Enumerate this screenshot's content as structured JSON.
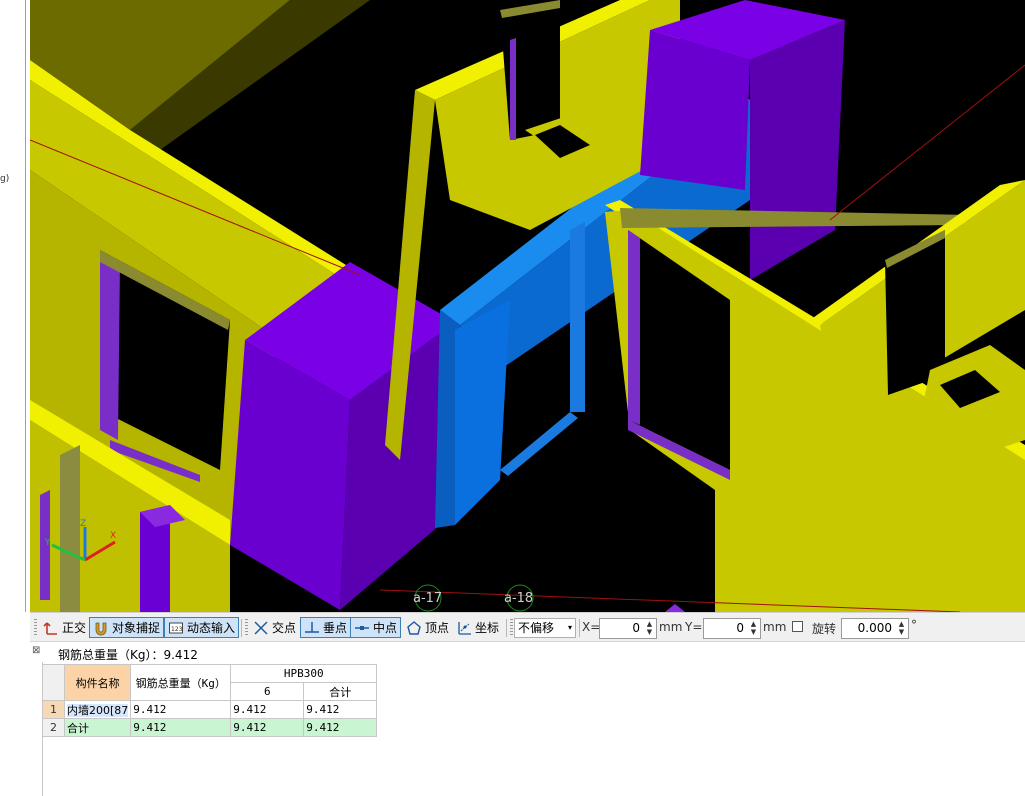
{
  "left_panel": {
    "fragment_text": "g)"
  },
  "viewport": {
    "axis_labels": [
      "a-17",
      "a-18"
    ],
    "colors": {
      "wall": "#d4d400",
      "wall_top": "#f0f000",
      "column": "#6a00d4",
      "beam": "#0a6fd6",
      "background": "#000000"
    }
  },
  "snap_toolbar": {
    "ortho": "正交",
    "object_snap": "对象捕捉",
    "dynamic_input": "动态输入",
    "intersection": "交点",
    "perpendicular": "垂点",
    "midpoint": "中点",
    "vertex": "顶点",
    "coordinate": "坐标",
    "offset_mode": "不偏移",
    "x_label": "X=",
    "x_value": "0",
    "x_unit": "mm",
    "y_label": "Y=",
    "y_value": "0",
    "y_unit": "mm",
    "rotate_label": "旋转",
    "rotate_value": "0.000",
    "degree": "°"
  },
  "rebar_panel": {
    "total_label": "钢筋总重量（Kg）：9.412",
    "headers": {
      "component_name": "构件名称",
      "total_weight": "钢筋总重量（Kg）",
      "grade": "HPB300",
      "diameter": "6",
      "subtotal": "合计"
    },
    "rows": [
      {
        "index": "1",
        "name": "内墙200[87",
        "total": "9.412",
        "d6": "9.412",
        "sum": "9.412"
      },
      {
        "index": "2",
        "name": "合计",
        "total": "9.412",
        "d6": "9.412",
        "sum": "9.412"
      }
    ]
  }
}
